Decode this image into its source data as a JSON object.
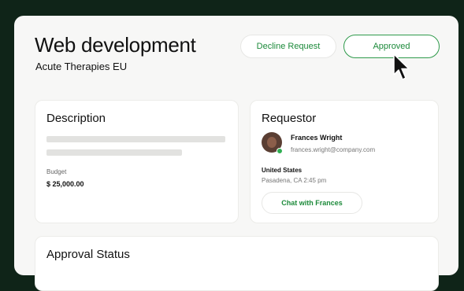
{
  "page": {
    "title": "Web development",
    "subtitle": "Acute Therapies EU"
  },
  "actions": {
    "decline_label": "Decline Request",
    "approve_label": "Approved"
  },
  "description": {
    "heading": "Description",
    "budget_label": "Budget",
    "budget_value": "$ 25,000.00"
  },
  "requestor": {
    "heading": "Requestor",
    "name": "Frances Wright",
    "email": "frances.wright@company.com",
    "country": "United States",
    "location": "Pasadena, CA 2:45 pm",
    "chat_label": "Chat with Frances",
    "status": "online",
    "status_color": "#2fae52"
  },
  "approval": {
    "heading": "Approval Status"
  },
  "colors": {
    "accent": "#1c8a3a",
    "background": "#0f2418"
  }
}
